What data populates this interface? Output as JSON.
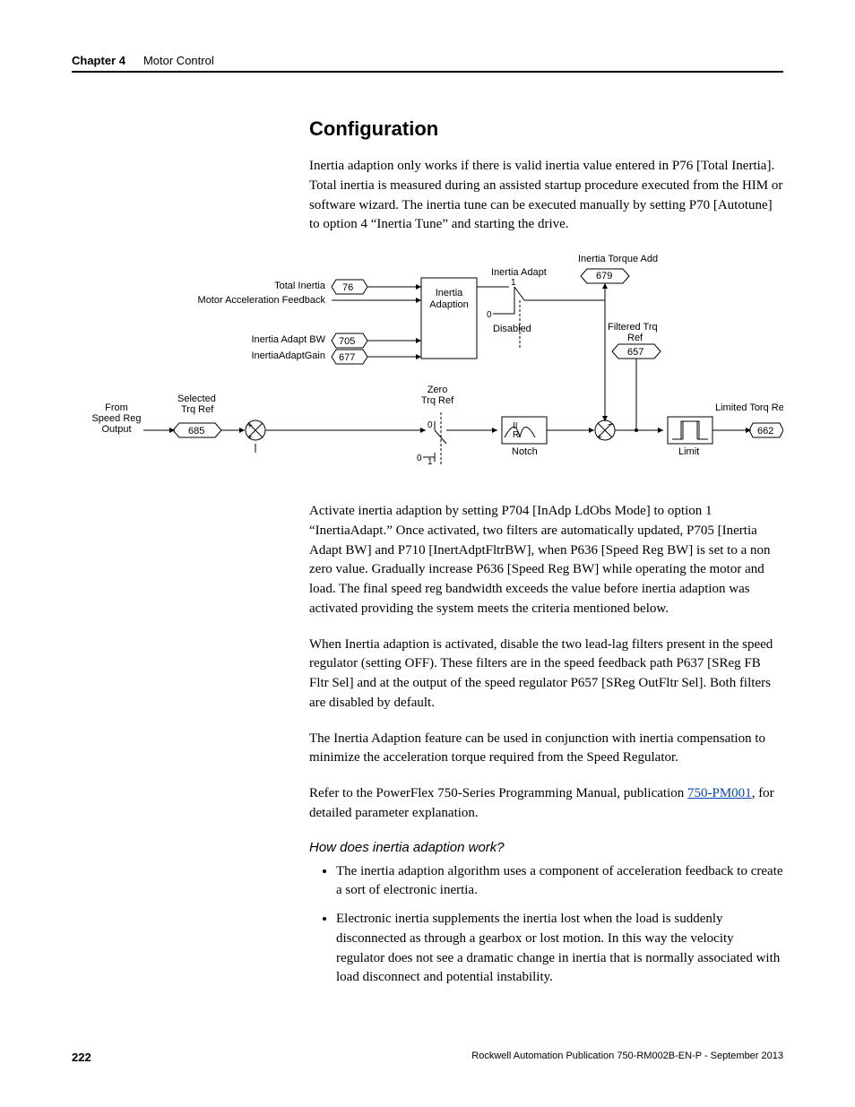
{
  "header": {
    "chapter": "Chapter 4",
    "title": "Motor Control"
  },
  "section_title": "Configuration",
  "para1": "Inertia adaption only works if there is valid inertia value entered in P76 [Total Inertia]. Total inertia is measured during an assisted startup procedure executed from the HIM or software wizard. The inertia tune can be executed manually by setting P70 [Autotune] to option 4 “Inertia Tune” and starting the drive.",
  "para2": "Activate inertia adaption by setting P704 [InAdp LdObs Mode] to option 1 “InertiaAdapt.” Once activated, two filters are automatically updated, P705 [Inertia Adapt BW] and P710 [InertAdptFltrBW], when P636 [Speed Reg BW] is set to a non zero value. Gradually increase P636 [Speed Reg BW] while operating the motor and load. The final speed reg bandwidth exceeds the value before inertia adaption was activated providing the system meets the criteria mentioned below.",
  "para3": "When Inertia adaption is activated, disable the two lead-lag filters present in the speed regulator (setting OFF). These filters are in the speed feedback path P637 [SReg FB Fltr Sel] and at the output of the speed regulator P657 [SReg OutFltr Sel]. Both filters are disabled by default.",
  "para4": "The Inertia Adaption feature can be used in conjunction with inertia compensation to minimize the acceleration torque required from the Speed Regulator.",
  "para5_prefix": "Refer to the PowerFlex 750-Series Programming Manual, publication ",
  "para5_link": "750-PM001",
  "para5_suffix": ", for detailed parameter explanation.",
  "subhead": "How does inertia adaption work?",
  "bullets": [
    "The inertia adaption algorithm uses a component of acceleration feedback to create a sort of electronic inertia.",
    "Electronic inertia supplements the inertia lost when the load is suddenly disconnected as through a gearbox or lost motion. In this way the velocity regulator does not see a dramatic change in inertia that is normally associated with load disconnect and potential instability."
  ],
  "chart_data": {
    "type": "diagram",
    "title": "Inertia Adaption signal flow diagram",
    "labels": {
      "inertia_torque_add": "Inertia Torque Add",
      "inertia_adapt": "Inertia Adapt",
      "total_inertia": "Total Inertia",
      "motor_accel_fb": "Motor Acceleration Feedback",
      "inertia_adapt_bw": "Inertia Adapt BW",
      "inertia_adapt_gain": "InertiaAdaptGain",
      "block_inertia_adaption": "Inertia\nAdaption",
      "disabled": "Disabled",
      "filtered_trq_ref": "Filtered Trq\nRef",
      "selected_trq_ref": "Selected\nTrq Ref",
      "zero_trq_ref": "Zero\nTrq Ref",
      "from_speed_reg": "From\nSpeed Reg\nOutput",
      "notch": "Notch",
      "iir": "II\nR",
      "limit": "Limit",
      "limited_torq_ref": "Limited Torq Ref",
      "switch_1": "1",
      "switch_0a": "0",
      "switch_0b": "0",
      "switch_0c": "0",
      "switch_1b": "1"
    },
    "params": {
      "p679": "679",
      "p76": "76",
      "p705": "705",
      "p677": "677",
      "p657": "657",
      "p685": "685",
      "p662": "662"
    }
  },
  "footer": {
    "page": "222",
    "pub": "Rockwell Automation Publication 750-RM002B-EN-P - September 2013"
  }
}
